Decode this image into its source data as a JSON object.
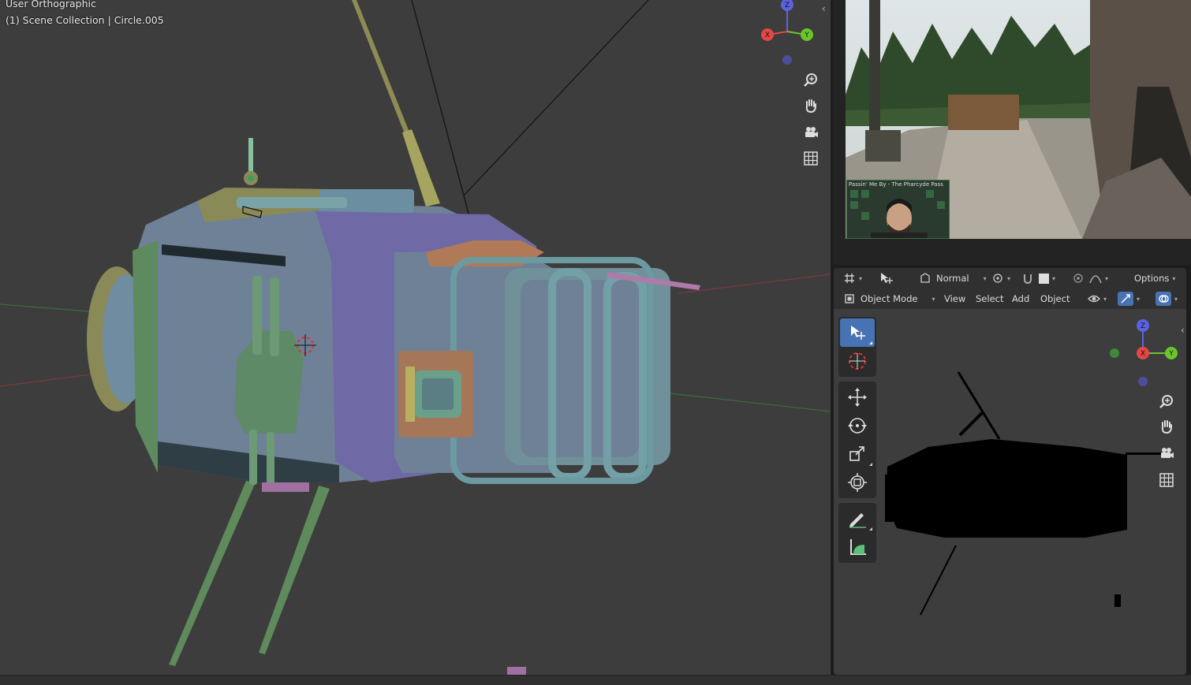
{
  "main_viewport": {
    "view_name": "User Orthographic",
    "collection_info": "(1) Scene Collection | Circle.005",
    "gizmo": {
      "z": "Z",
      "x": "X",
      "y": "Y"
    },
    "nav_icons": [
      "zoom-icon",
      "pan-hand-icon",
      "camera-icon",
      "grid-icon"
    ]
  },
  "stream": {
    "webcam_caption": "Passin' Me By - The Pharcyde  Pass"
  },
  "right_viewport": {
    "tools_header": {
      "transform_orientation": "Normal",
      "options_label": "Options"
    },
    "menu_header": {
      "mode": "Object Mode",
      "menus": [
        "View",
        "Select",
        "Add",
        "Object"
      ]
    },
    "gizmo": {
      "z": "Z",
      "x": "X",
      "y": "Y"
    },
    "toolbar": [
      "select-box",
      "cursor",
      "move",
      "rotate",
      "scale",
      "transform",
      "annotate",
      "measure"
    ]
  },
  "colors": {
    "viewport_bg": "#3d3d3d",
    "header_bg": "#303030",
    "active_tool": "#4772b3",
    "axis_x": "#e54646",
    "axis_y": "#6ac52c",
    "axis_z": "#5b62e0"
  }
}
